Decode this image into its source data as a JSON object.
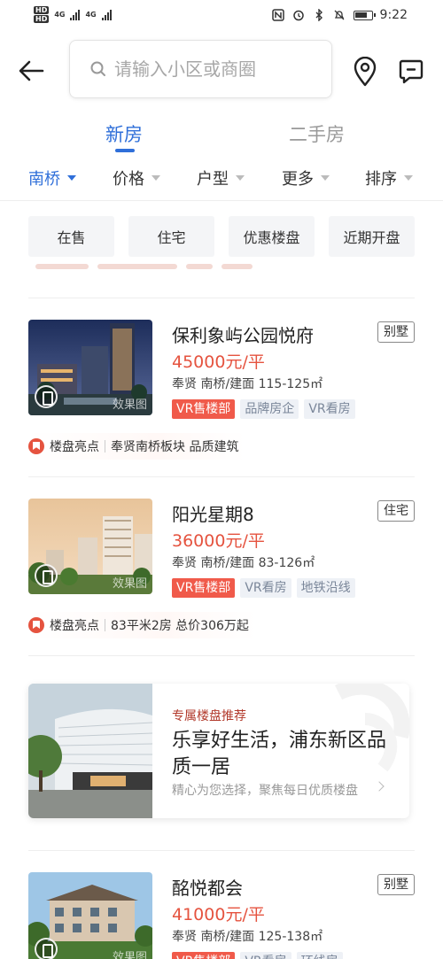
{
  "status_bar": {
    "hd1": "HD",
    "hd2": "HD",
    "signal1": "4G",
    "signal2": "4G",
    "time": "9:22"
  },
  "search": {
    "placeholder": "请输入小区或商圈"
  },
  "tabs": [
    {
      "label": "新房",
      "active": true
    },
    {
      "label": "二手房",
      "active": false
    }
  ],
  "filters": [
    {
      "label": "南桥",
      "active": true
    },
    {
      "label": "价格",
      "active": false
    },
    {
      "label": "户型",
      "active": false
    },
    {
      "label": "更多",
      "active": false
    },
    {
      "label": "排序",
      "active": false
    }
  ],
  "quick_tags": [
    "在售",
    "住宅",
    "优惠楼盘",
    "近期开盘"
  ],
  "listings": [
    {
      "name": "保利象屿公园悦府",
      "type": "别墅",
      "price": "45000元/平",
      "area": "奉贤 南桥/建面 115-125㎡",
      "badges": [
        "VR售楼部",
        "品牌房企",
        "VR看房"
      ],
      "highlight_label": "楼盘亮点",
      "highlight_text": "奉贤南桥板块 品质建筑",
      "image_caption": "效果图"
    },
    {
      "name": "阳光星期8",
      "type": "住宅",
      "price": "36000元/平",
      "area": "奉贤 南桥/建面 83-126㎡",
      "badges": [
        "VR售楼部",
        "VR看房",
        "地铁沿线"
      ],
      "highlight_label": "楼盘亮点",
      "highlight_text": "83平米2房 总价306万起",
      "image_caption": "效果图"
    },
    {
      "name": "酩悦都会",
      "type": "别墅",
      "price": "41000元/平",
      "area": "奉贤 南桥/建面 125-138㎡",
      "badges": [
        "VR售楼部",
        "VR看房",
        "环线房"
      ],
      "image_caption": "效果图"
    }
  ],
  "promo": {
    "tag": "专属楼盘推荐",
    "headline": "乐享好生活，浦东新区品质一居",
    "subtitle": "精心为您选择，聚焦每日优质楼盘"
  },
  "colors": {
    "accent_blue": "#2f6fd9",
    "price_red": "#e5533f",
    "badge_red": "#f05a4a"
  }
}
